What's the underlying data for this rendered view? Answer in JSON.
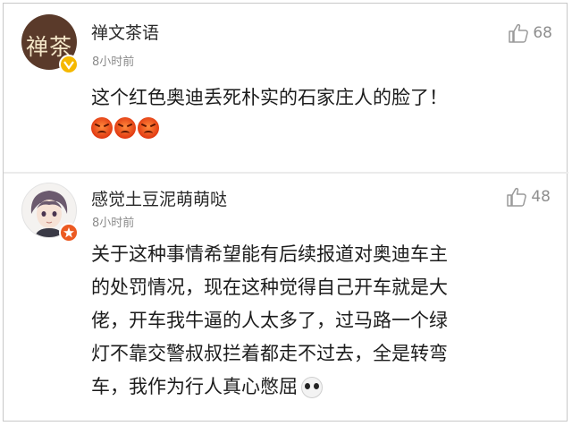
{
  "comments": [
    {
      "username": "禅文茶语",
      "avatar_text": "禅茶",
      "time": "8小时前",
      "likes": "68",
      "text": "这个红色奥迪丢死朴实的石家庄人的脸了！",
      "emojis": [
        "angry-face",
        "angry-face",
        "angry-face"
      ]
    },
    {
      "username": "感觉土豆泥萌萌哒",
      "time": "8小时前",
      "likes": "48",
      "lines": [
        "关于这种事情希望能有后续报道对奥迪车主",
        "的处罚情况，现在这种觉得自己开车就是大",
        "佬，开车我牛逼的人太多了，过马路一个绿",
        "灯不靠交警叔叔拦着都走不过去，全是转弯",
        "车，我作为行人真心憋屈"
      ],
      "emoji": "panda-face"
    }
  ],
  "colors": {
    "verified_gold": "#f5b800",
    "verified_orange": "#ec5a22",
    "text": "#1c1c1c",
    "meta": "#8b8b8b"
  }
}
